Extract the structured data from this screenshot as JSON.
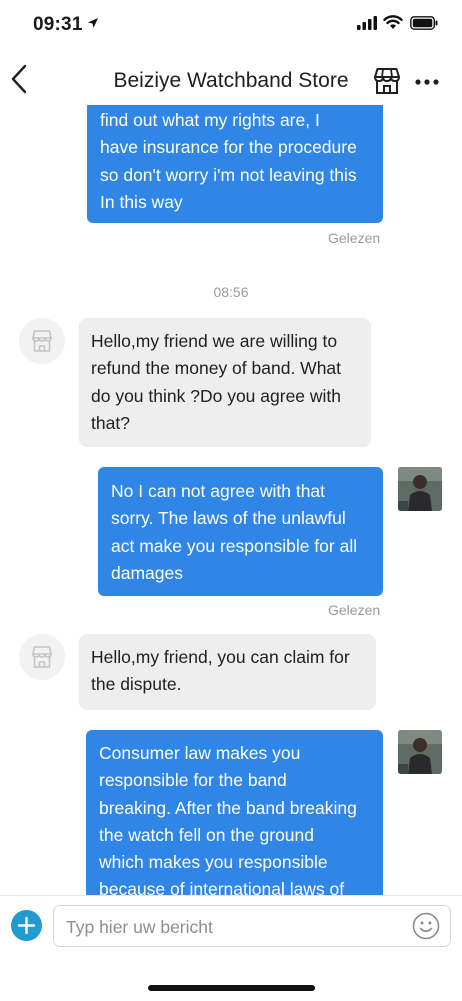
{
  "status_bar": {
    "time": "09:31"
  },
  "header": {
    "title": "Beiziye Watchband Store"
  },
  "messages": [
    {
      "side": "out",
      "text": "find out what my rights are, I\nhave insurance for the procedure\nso don't worry i'm not leaving this\nIn this way",
      "receipt": "Gelezen"
    },
    {
      "timestamp": "08:56"
    },
    {
      "side": "in",
      "text": "Hello,my friend we are willing to\nrefund the money of band. What\ndo you think ?Do you agree with\nthat?"
    },
    {
      "side": "out",
      "text": "No I can not agree with that\nsorry. The laws of the unlawful\nact make you responsible for all\ndamages",
      "receipt": "Gelezen"
    },
    {
      "side": "in",
      "text": "Hello,my friend, you can claim for\nthe dispute."
    },
    {
      "side": "out",
      "text": "Consumer law makes you\nresponsible for the band\nbreaking. After the band breaking\nthe watch fell on the ground\nwhich makes you responsible\nbecause of international laws of"
    }
  ],
  "composer": {
    "placeholder": "Typ hier uw bericht"
  },
  "colors": {
    "outgoing_bubble": "#2f86e6",
    "incoming_bubble": "#eeeeee",
    "plus_button": "#1f9bd2"
  }
}
